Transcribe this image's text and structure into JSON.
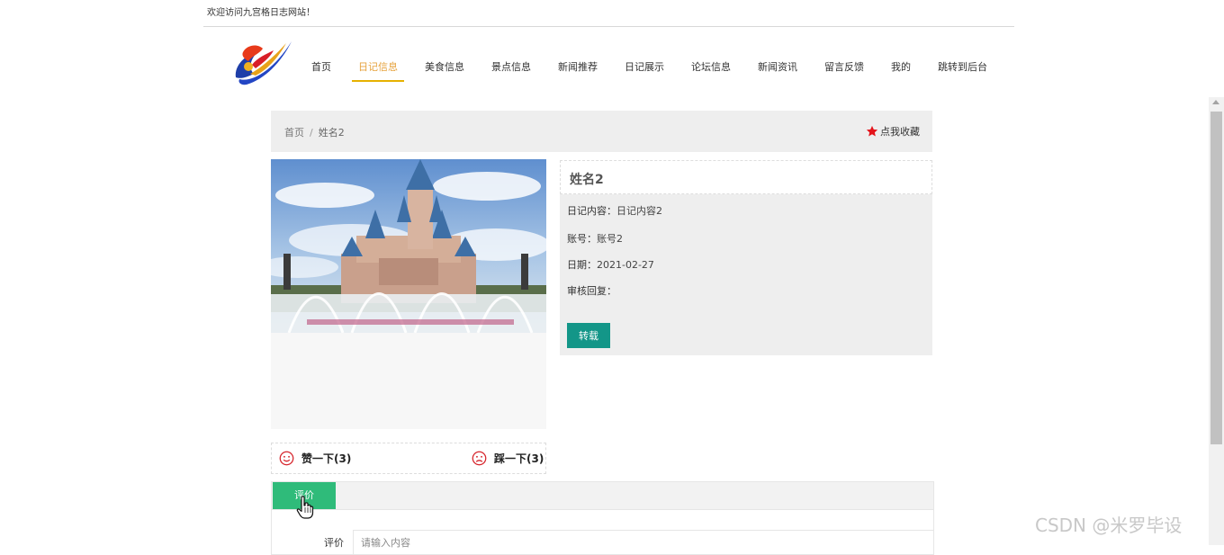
{
  "header": {
    "welcome": "欢迎访问九宫格日志网站！"
  },
  "nav": {
    "items": [
      {
        "label": "首页",
        "active": false
      },
      {
        "label": "日记信息",
        "active": true
      },
      {
        "label": "美食信息",
        "active": false
      },
      {
        "label": "景点信息",
        "active": false
      },
      {
        "label": "新闻推荐",
        "active": false
      },
      {
        "label": "日记展示",
        "active": false
      },
      {
        "label": "论坛信息",
        "active": false
      },
      {
        "label": "新闻资讯",
        "active": false
      },
      {
        "label": "留言反馈",
        "active": false
      },
      {
        "label": "我的",
        "active": false
      },
      {
        "label": "跳转到后台",
        "active": false
      }
    ],
    "active_color": "#e6a23c"
  },
  "breadcrumb": {
    "home": "首页",
    "separator": "/",
    "current": "姓名2",
    "favorite_label": "点我收藏",
    "favorite_icon": "star-icon",
    "favorite_color": "#e4141b"
  },
  "detail": {
    "title": "姓名2",
    "fields": [
      {
        "label": "日记内容：",
        "value": "日记内容2"
      },
      {
        "label": "账号：",
        "value": "账号2"
      },
      {
        "label": "日期：",
        "value": "2021-02-27"
      },
      {
        "label": "审核回复：",
        "value": ""
      }
    ],
    "reprint_label": "转载",
    "reprint_color": "#139688"
  },
  "votes": {
    "like_label": "赞一下(3)",
    "dislike_label": "踩一下(3)",
    "icon_color": "#d6252c"
  },
  "comment": {
    "tab_label": "评价",
    "tab_color": "#2fbb7a",
    "field_label": "评价",
    "placeholder": "请输入内容"
  },
  "watermark": "CSDN @米罗毕设"
}
